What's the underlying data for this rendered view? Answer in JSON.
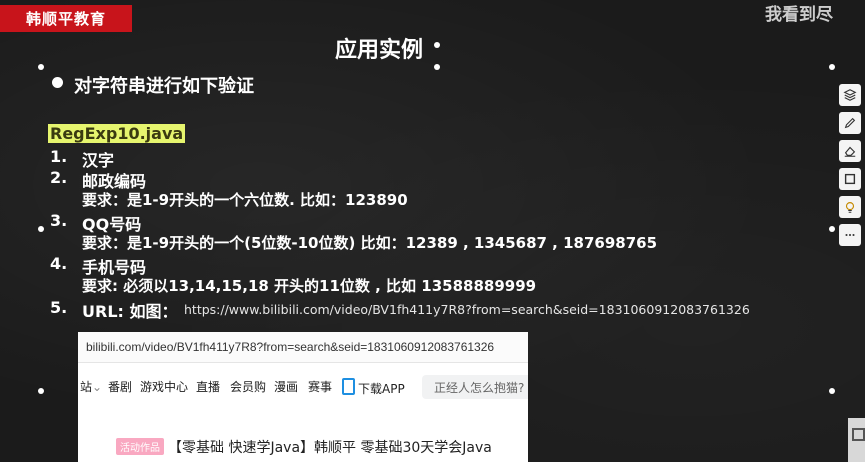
{
  "brand": {
    "logo_text": "韩顺平教育",
    "logo_color": "#c8141b"
  },
  "watermark": "我看到尽",
  "slide": {
    "title": "应用实例",
    "heading": "对字符串进行如下验证",
    "file_name": "RegExp10",
    "file_ext": ".java",
    "items": [
      {
        "num": "1.",
        "label": "汉字"
      },
      {
        "num": "2.",
        "label": "邮政编码",
        "req": "要求：是1-9开头的一个六位数. 比如：123890"
      },
      {
        "num": "3.",
        "label": "QQ号码",
        "req": "要求：是1-9开头的一个(5位数-10位数)  比如：12389 , 1345687 , 187698765"
      },
      {
        "num": "4.",
        "label": "手机号码",
        "req": "要求: 必须以13,14,15,18 开头的11位数 , 比如 13588889999"
      },
      {
        "num": "5.",
        "label": "URL: 如图：",
        "url": "https://www.bilibili.com/video/BV1fh411y7R8?from=search&seid=1831060912083761326"
      }
    ]
  },
  "screenshot": {
    "address": "bilibili.com/video/BV1fh411y7R8?from=search&seid=1831060912083761326",
    "nav": [
      "站",
      "番剧",
      "游戏中心",
      "直播",
      "会员购",
      "漫画",
      "赛事",
      "下载APP"
    ],
    "search_placeholder": "正经人怎么抱猫?",
    "promo_tag": "活动作品",
    "promo_title": "【零基础 快速学Java】韩顺平 零基础30天学会Java"
  },
  "toolbar": [
    "layers-icon",
    "pen-icon",
    "eraser-icon",
    "frame-icon",
    "bulb-icon",
    "more-icon"
  ]
}
